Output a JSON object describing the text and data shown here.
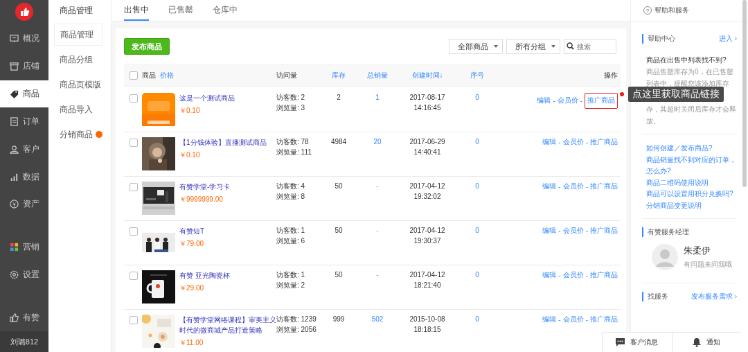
{
  "sidebar": {
    "items": [
      {
        "label": "概况",
        "kind": "overview",
        "selected": false
      },
      {
        "label": "店铺",
        "kind": "store",
        "selected": false
      },
      {
        "label": "商品",
        "kind": "tag",
        "selected": true
      },
      {
        "label": "订单",
        "kind": "order",
        "selected": false
      },
      {
        "label": "客户",
        "kind": "customer",
        "selected": false
      },
      {
        "label": "数据",
        "kind": "data",
        "selected": false
      },
      {
        "label": "资产",
        "kind": "asset",
        "selected": false
      },
      {
        "label": "营销",
        "kind": "marketing",
        "selected": false
      },
      {
        "label": "设置",
        "kind": "settings",
        "selected": false
      },
      {
        "label": "有赞",
        "kind": "like",
        "selected": false
      }
    ],
    "user": "刘璐812"
  },
  "subnav": {
    "title": "商品管理",
    "items": [
      {
        "label": "商品管理",
        "selected": true,
        "badge": false
      },
      {
        "label": "商品分组",
        "selected": false,
        "badge": false
      },
      {
        "label": "商品页模版",
        "selected": false,
        "badge": false
      },
      {
        "label": "商品导入",
        "selected": false,
        "badge": false
      },
      {
        "label": "分销商品",
        "selected": false,
        "badge": true
      }
    ]
  },
  "tabs": [
    {
      "label": "出售中",
      "selected": true
    },
    {
      "label": "已售罄",
      "selected": false
    },
    {
      "label": "仓库中",
      "selected": false
    }
  ],
  "publish_button": "发布商品",
  "filters": [
    "全部商品",
    "所有分组"
  ],
  "search": {
    "placeholder": "搜索"
  },
  "table": {
    "columns": [
      {
        "label": "商品",
        "sortable": false
      },
      {
        "label": "价格",
        "sortable": true
      },
      {
        "label": "访问量",
        "sortable": false
      },
      {
        "label": "库存",
        "sortable": true
      },
      {
        "label": "总销量",
        "sortable": true
      },
      {
        "label": "创建时间↓",
        "sortable": true
      },
      {
        "label": "序号",
        "sortable": true
      },
      {
        "label": "操作",
        "sortable": false
      }
    ],
    "separator": "-",
    "select_all_checked": false,
    "rows": [
      {
        "name": "这是一个测试商品",
        "price": "￥0.10",
        "visitors": "访客数: 2",
        "views": "浏览量: 3",
        "stock": "2",
        "sales": "1",
        "sales_link": true,
        "date": "2017-08-17",
        "time": "14:16:45",
        "seq": "0",
        "actions": [
          "编辑",
          "会员价",
          "推广商品"
        ],
        "highlighted": true,
        "checked": false
      },
      {
        "name": "【1分钱体验】直播测试商品",
        "price": "￥0.10",
        "visitors": "访客数: 78",
        "views": "浏览量: 111",
        "stock": "4984",
        "sales": "20",
        "sales_link": true,
        "date": "2017-06-29",
        "time": "14:40:41",
        "seq": "0",
        "actions": [
          "编辑",
          "会员价",
          "推广商品"
        ],
        "highlighted": false,
        "checked": false
      },
      {
        "name": "有赞学堂-学习卡",
        "price": "￥9999999.00",
        "visitors": "访客数: 4",
        "views": "浏览量: 8",
        "stock": "50",
        "sales": "-",
        "sales_link": false,
        "date": "2017-04-12",
        "time": "19:32:02",
        "seq": "0",
        "actions": [
          "编辑",
          "会员价",
          "推广商品"
        ],
        "highlighted": false,
        "checked": false
      },
      {
        "name": "有赞短T",
        "price": "￥79.00",
        "visitors": "访客数: 1",
        "views": "浏览量: 6",
        "stock": "50",
        "sales": "-",
        "sales_link": false,
        "date": "2017-04-12",
        "time": "19:30:37",
        "seq": "0",
        "actions": [
          "编辑",
          "会员价",
          "推广商品"
        ],
        "highlighted": false,
        "checked": false
      },
      {
        "name": "有赞 亚光陶瓷杯",
        "price": "￥29.00",
        "visitors": "访客数: 1",
        "views": "浏览量: 2",
        "stock": "50",
        "sales": "-",
        "sales_link": false,
        "date": "2017-04-12",
        "time": "18:21:40",
        "seq": "0",
        "actions": [
          "编辑",
          "会员价",
          "推广商品"
        ],
        "highlighted": false,
        "checked": false
      },
      {
        "name": "【有赞学堂网络课程】审美主义时代的微商城产品打造策略",
        "price": "￥11.00",
        "visitors": "访客数: 1239",
        "views": "浏览量: 2056",
        "stock": "999",
        "sales": "502",
        "sales_link": true,
        "date": "2015-10-08",
        "time": "18:18:15",
        "seq": "0",
        "actions": [
          "编辑",
          "会员价",
          "推广商品"
        ],
        "highlighted": false,
        "checked": false
      }
    ]
  },
  "callout": "点这里获取商品链接",
  "help": {
    "icon": "?",
    "title": "帮助和服务",
    "center": {
      "heading": "帮助中心",
      "more": "进入 ›",
      "question": "商品在出售中列表找不到?",
      "answer_top": "商品售罄库存为0，在已售罄列表中，提醒您该添加库存",
      "answer_bottom": "存，其超时关闭后库存才会释放。",
      "links": [
        "如何创建／发布商品?",
        "商品销量找不到对应的订单，怎么办?",
        "商品二维码使用说明",
        "商品可以设置用积分兑换吗?",
        "分销商品变更说明"
      ]
    },
    "manager": {
      "heading": "有赞服务经理",
      "name": "朱柔伊",
      "note": "有问题来问我哦"
    },
    "service": {
      "heading": "找服务",
      "more": "发布服务需求 ›"
    }
  },
  "bottom_bar": [
    "客户消息",
    "通知"
  ]
}
